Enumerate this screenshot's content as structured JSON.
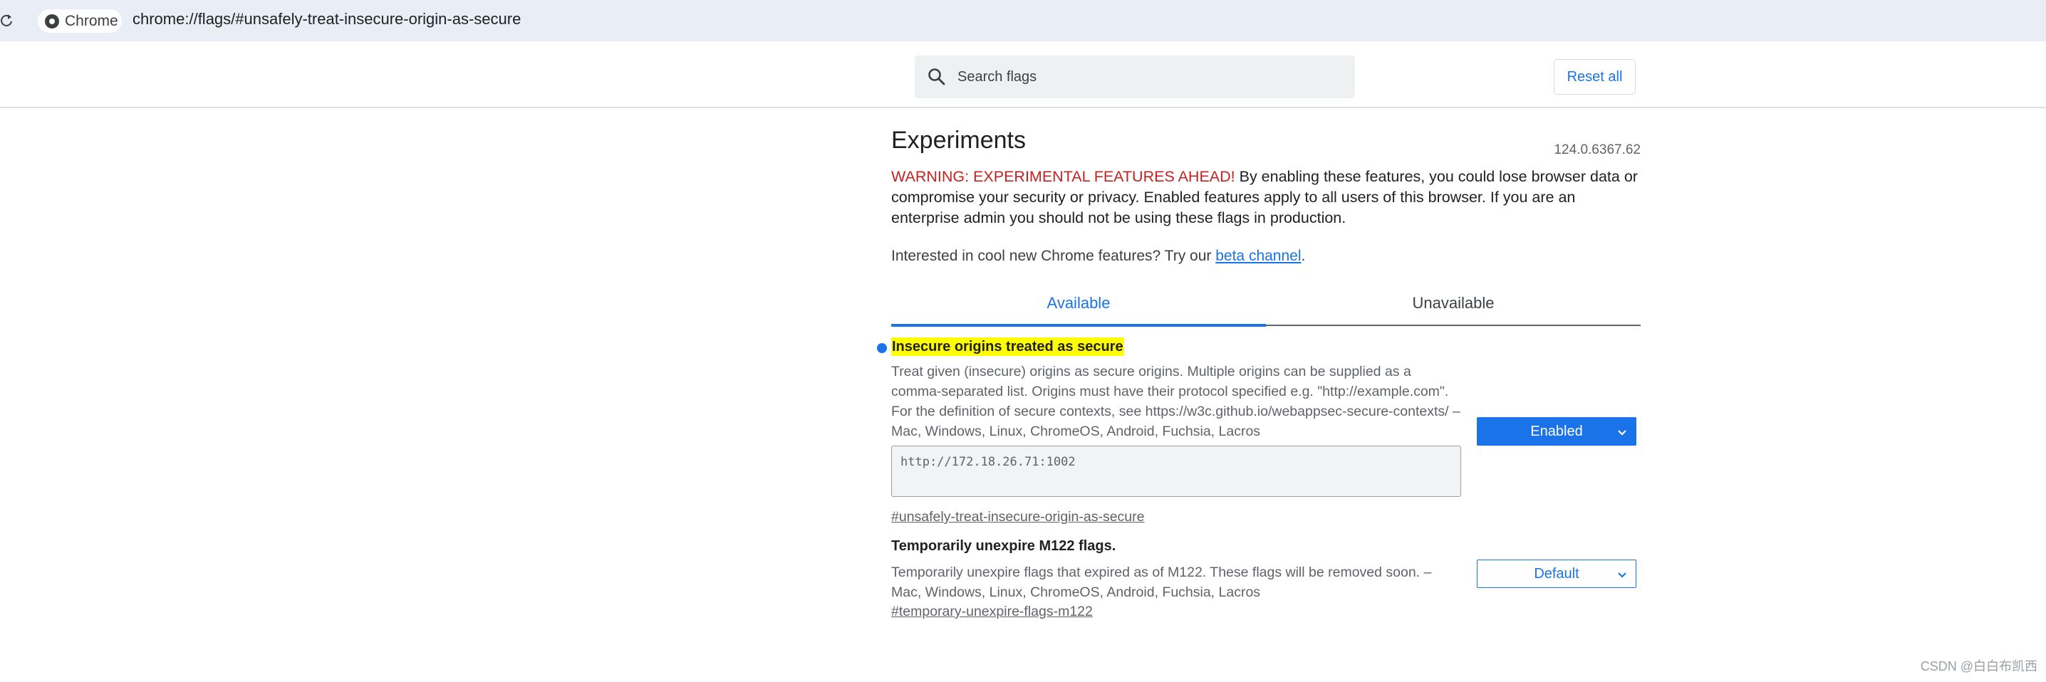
{
  "browser": {
    "chip_label": "Chrome",
    "url": "chrome://flags/#unsafely-treat-insecure-origin-as-secure"
  },
  "header": {
    "search_placeholder": "Search flags",
    "reset_label": "Reset all"
  },
  "page": {
    "title": "Experiments",
    "version": "124.0.6367.62",
    "warning_prefix": "WARNING: EXPERIMENTAL FEATURES AHEAD!",
    "warning_body": " By enabling these features, you could lose browser data or compromise your security or privacy. Enabled features apply to all users of this browser. If you are an enterprise admin you should not be using these flags in production.",
    "interest_text": "Interested in cool new Chrome features? Try our ",
    "beta_link": "beta channel",
    "interest_suffix": "."
  },
  "tabs": [
    {
      "label": "Available",
      "active": true
    },
    {
      "label": "Unavailable",
      "active": false
    }
  ],
  "experiments": [
    {
      "name": "Insecure origins treated as secure",
      "description": "Treat given (insecure) origins as secure origins. Multiple origins can be supplied as a comma-separated list. Origins must have their protocol specified e.g. \"http://example.com\". For the definition of secure contexts, see https://w3c.github.io/webappsec-secure-contexts/ – Mac, Windows, Linux, ChromeOS, Android, Fuchsia, Lacros",
      "text_value": "http://172.18.26.71:1002",
      "permalink": "#unsafely-treat-insecure-origin-as-secure",
      "state": "Enabled"
    },
    {
      "name": "Temporarily unexpire M122 flags.",
      "description": "Temporarily unexpire flags that expired as of M122. These flags will be removed soon. – Mac, Windows, Linux, ChromeOS, Android, Fuchsia, Lacros",
      "permalink": "#temporary-unexpire-flags-m122",
      "state": "Default"
    }
  ],
  "watermark": "CSDN @白白布凯西",
  "colors": {
    "accent": "#1a73e8",
    "warning_red": "#c5221f",
    "highlight": "#ffff00",
    "address_bar_bg": "#e9edf6"
  }
}
